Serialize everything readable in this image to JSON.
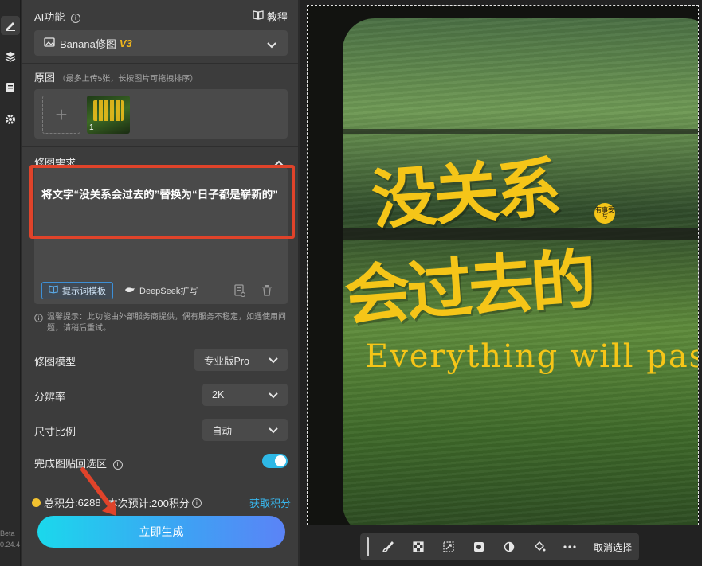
{
  "rail": {
    "icons": [
      "edit-icon",
      "layers-icon",
      "document-icon",
      "gear-icon"
    ],
    "version_label": "Beta",
    "version_number": "0.24.4"
  },
  "ai_section": {
    "title": "AI功能",
    "tutorial_label": "教程",
    "model_name": "Banana修图",
    "model_version": "V3"
  },
  "source_section": {
    "title": "原图",
    "hint": "（最多上传5张，长按图片可拖拽排序）",
    "thumb_index": "1"
  },
  "edit_section": {
    "title": "修图需求",
    "prompt_text": "将文字“没关系会过去的”替换为“日子都是崭新的”",
    "template_chip": "提示词模板",
    "deepseek_chip": "DeepSeek扩写",
    "notice": "温馨提示：此功能由外部服务商提供，偶有服务不稳定，如遇使用问题，请稍后重试。"
  },
  "settings": {
    "model_label": "修图模型",
    "model_value": "专业版Pro",
    "resolution_label": "分辨率",
    "resolution_value": "2K",
    "ratio_label": "尺寸比例",
    "ratio_value": "自动",
    "paste_back_label": "完成图贴回选区",
    "paste_back_on": true
  },
  "footer": {
    "points_prefix": "总积分",
    "points_value": ":6288",
    "estimate": "本次预计:200积分",
    "get_points": "获取积分",
    "generate_button": "立即生成"
  },
  "canvas": {
    "title_line1": "没关系",
    "title_line2": "会过去的",
    "tagline": "Everything will pass.",
    "stamp_text": "有事要写"
  },
  "toolbar": {
    "icons": [
      "brush-icon",
      "checker-icon",
      "transform-icon",
      "mask-icon",
      "contrast-icon",
      "fill-icon",
      "more-icon"
    ],
    "deselect_label": "取消选择"
  },
  "colors": {
    "accent": "#38b9f0",
    "highlight_red": "#e0432a",
    "text_yellow": "#f5c518"
  }
}
